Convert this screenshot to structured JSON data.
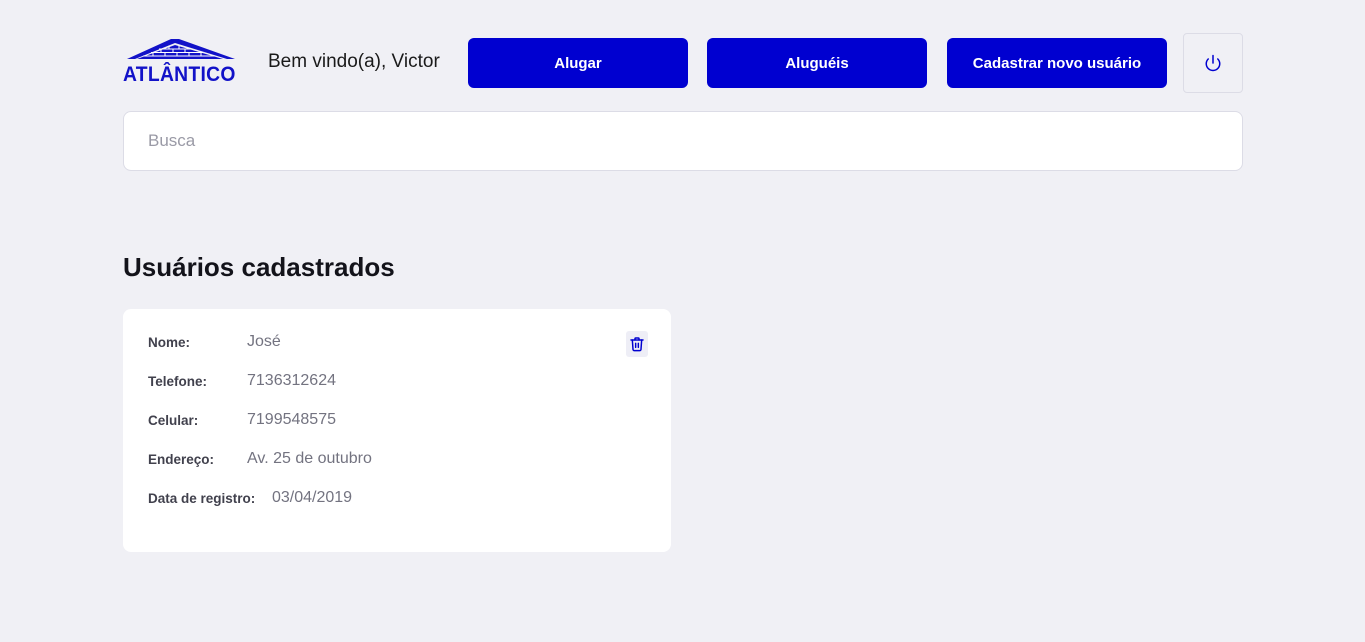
{
  "header": {
    "logo_text": "ATLÂNTICO",
    "welcome": "Bem vindo(a), Victor",
    "buttons": {
      "rent": "Alugar",
      "rentals": "Aluguéis",
      "register_user": "Cadastrar novo usuário"
    },
    "logout_icon": "power-icon"
  },
  "search": {
    "placeholder": "Busca",
    "value": ""
  },
  "section_title": "Usuários cadastrados",
  "users": [
    {
      "fields": [
        {
          "label": "Nome:",
          "value": "José"
        },
        {
          "label": "Telefone:",
          "value": "7136312624"
        },
        {
          "label": "Celular:",
          "value": "7199548575"
        },
        {
          "label": "Endereço:",
          "value": "Av. 25 de outubro"
        },
        {
          "label": "Data de registro:",
          "value": "03/04/2019"
        }
      ],
      "delete_icon": "trash-icon"
    }
  ],
  "colors": {
    "brand": "#0000d0",
    "background": "#f0f0f5",
    "card": "#ffffff",
    "label": "#41414d",
    "value": "#737380"
  }
}
